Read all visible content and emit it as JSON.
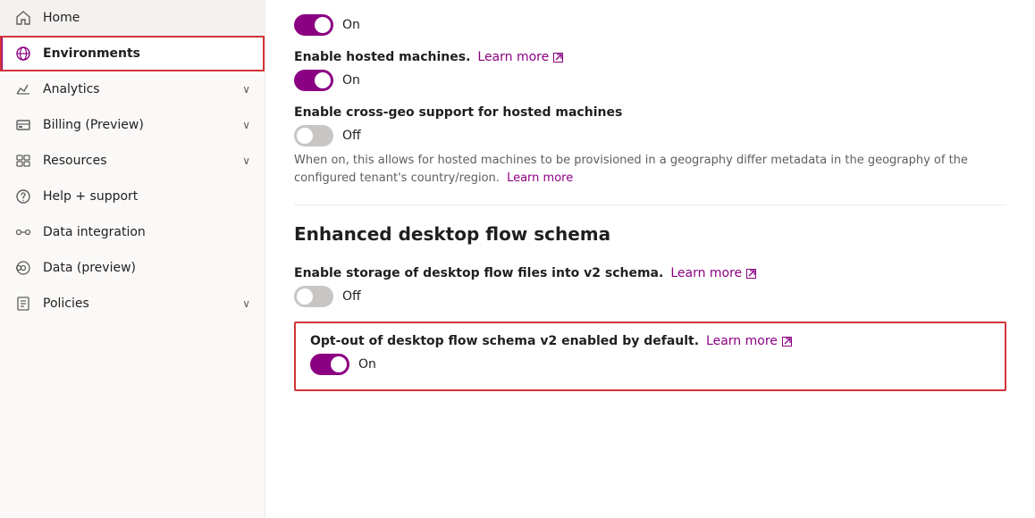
{
  "sidebar": {
    "items": [
      {
        "id": "home",
        "label": "Home",
        "icon": "home",
        "active": false,
        "hasChevron": false
      },
      {
        "id": "environments",
        "label": "Environments",
        "icon": "globe",
        "active": true,
        "hasChevron": false
      },
      {
        "id": "analytics",
        "label": "Analytics",
        "icon": "analytics",
        "active": false,
        "hasChevron": true
      },
      {
        "id": "billing",
        "label": "Billing (Preview)",
        "icon": "billing",
        "active": false,
        "hasChevron": true
      },
      {
        "id": "resources",
        "label": "Resources",
        "icon": "resources",
        "active": false,
        "hasChevron": true
      },
      {
        "id": "help-support",
        "label": "Help + support",
        "icon": "help",
        "active": false,
        "hasChevron": false
      },
      {
        "id": "data-integration",
        "label": "Data integration",
        "icon": "data-integration",
        "active": false,
        "hasChevron": false
      },
      {
        "id": "data-preview",
        "label": "Data (preview)",
        "icon": "data-preview",
        "active": false,
        "hasChevron": false
      },
      {
        "id": "policies",
        "label": "Policies",
        "icon": "policies",
        "active": false,
        "hasChevron": true
      }
    ]
  },
  "main": {
    "topToggle": {
      "state": "on",
      "stateLabel": "On"
    },
    "hostedMachines": {
      "label": "Enable hosted machines.",
      "learnMoreText": "Learn more",
      "toggleState": "on",
      "toggleStateLabel": "On"
    },
    "crossGeo": {
      "label": "Enable cross-geo support for hosted machines",
      "toggleState": "off",
      "toggleStateLabel": "Off",
      "description": "When on, this allows for hosted machines to be provisioned in a geography differ metadata in the geography of the configured tenant's country/region.",
      "learnMoreText": "Learn more"
    },
    "enhancedSchema": {
      "sectionTitle": "Enhanced desktop flow schema",
      "storageLabel": "Enable storage of desktop flow files into v2 schema.",
      "storageLearnMoreText": "Learn more",
      "storageToggleState": "off",
      "storageToggleStateLabel": "Off",
      "optOutLabel": "Opt-out of desktop flow schema v2 enabled by default.",
      "optOutLearnMoreText": "Learn more",
      "optOutToggleState": "on",
      "optOutToggleStateLabel": "On"
    }
  }
}
